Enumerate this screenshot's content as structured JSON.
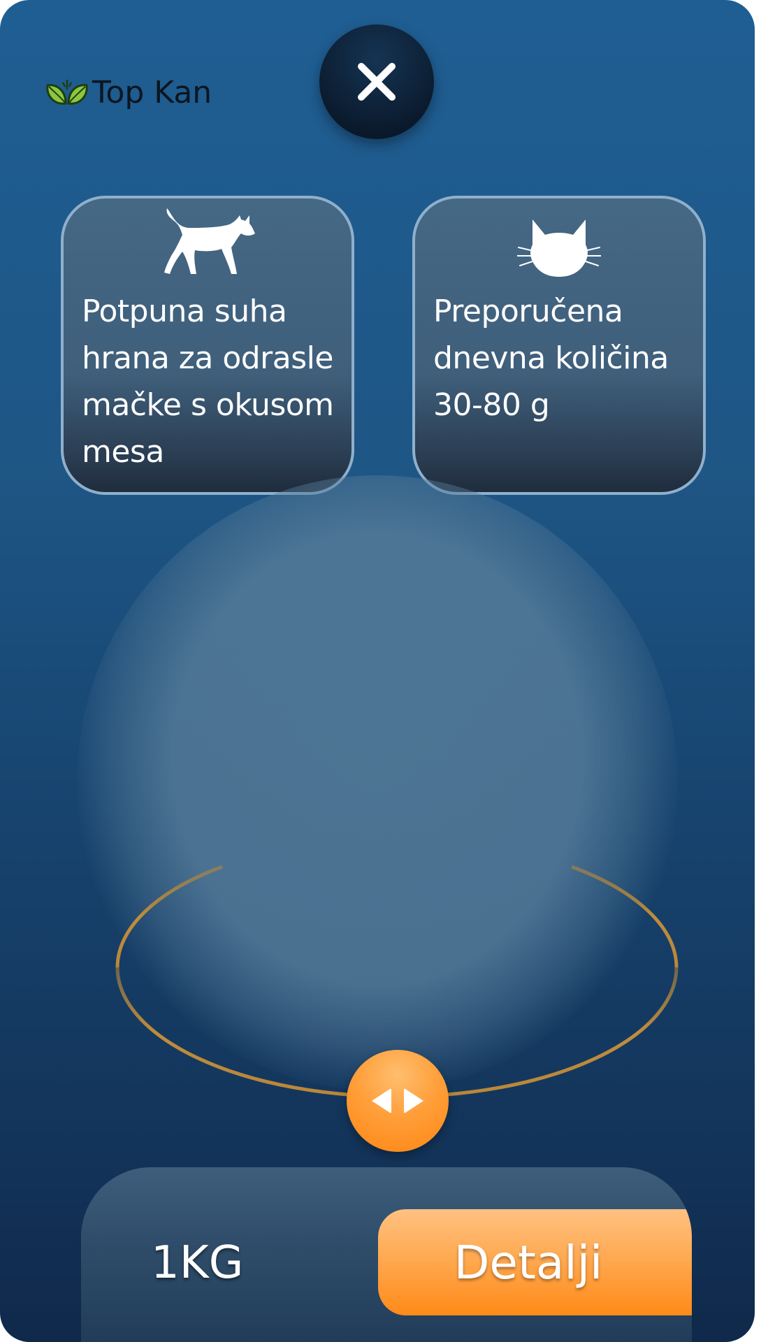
{
  "app": {
    "brand": "Top Kan",
    "brand_colors": {
      "leaf_light": "#8cc63f",
      "leaf_dark": "#3b7a1e"
    }
  },
  "header": {
    "close_icon": "close-icon"
  },
  "cards": [
    {
      "icon": "walking-cat-icon",
      "text": "Potpuna suha hrana za odrasle mačke s okusom mesa"
    },
    {
      "icon": "cat-face-icon",
      "text": "Preporučena dnevna količina 30-80 g"
    }
  ],
  "viewer": {
    "rotate_icon": "left-right-arrows-icon",
    "ring_color": "#b8873a"
  },
  "footer": {
    "weight": "1KG",
    "details_label": "Detalji",
    "accent_color": "#ff8a18"
  }
}
